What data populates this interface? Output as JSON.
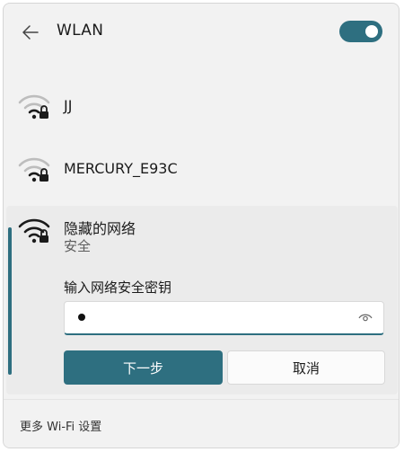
{
  "header": {
    "title": "WLAN",
    "toggle_on": true
  },
  "networks": [
    {
      "name": "JJ",
      "secured": true
    },
    {
      "name": "MERCURY_E93C",
      "secured": true
    }
  ],
  "expanded_network": {
    "name": "隐藏的网络",
    "security": "安全",
    "key_label": "输入网络安全密钥",
    "password_mask": "●",
    "next_label": "下一步",
    "cancel_label": "取消"
  },
  "footer": {
    "more_settings": "更多 Wi-Fi 设置"
  },
  "colors": {
    "accent": "#2e6f80",
    "panel_bg": "#f2f2f2",
    "selected_bg": "#ebebeb"
  },
  "icons": {
    "back": "back-arrow-icon",
    "wifi_secured": "wifi-lock-icon",
    "show_password": "eye-icon"
  }
}
